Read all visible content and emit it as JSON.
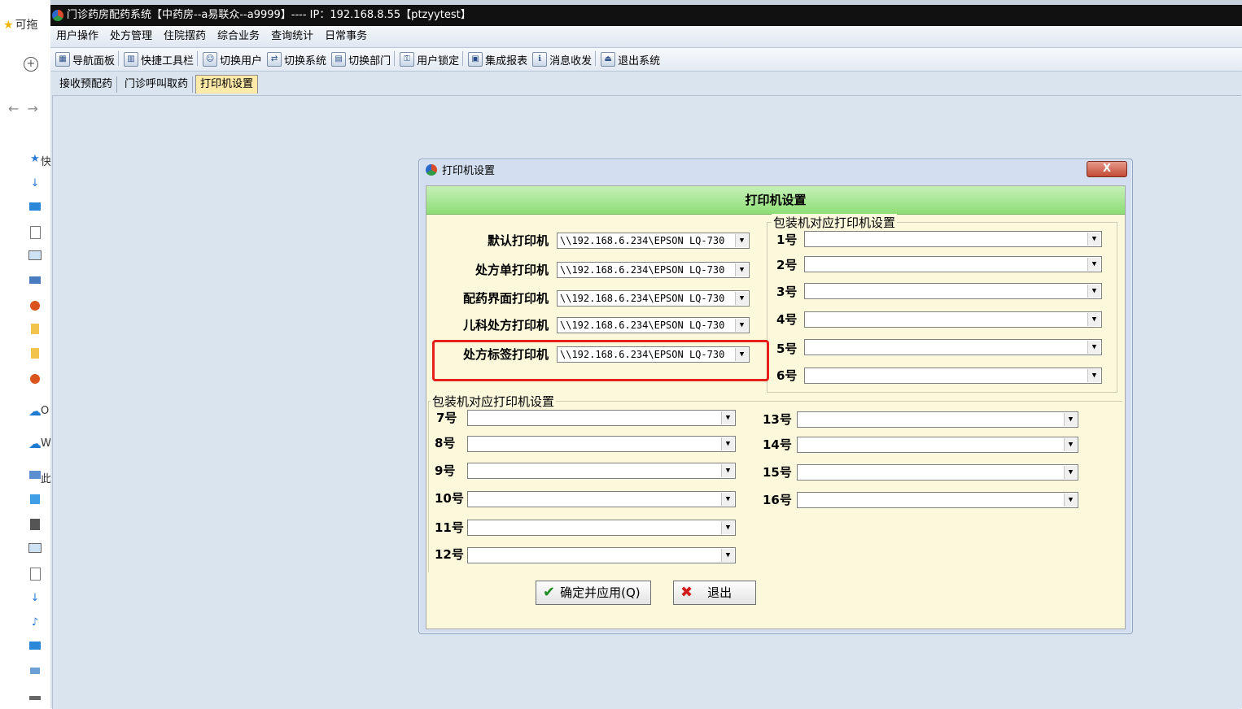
{
  "left_panel": {
    "favorites_label": "可拖",
    "items": [
      {
        "icon": "quick-access-icon",
        "text": "快"
      },
      {
        "icon": "onedrive-icon",
        "text": "O"
      },
      {
        "icon": "onedrive-cloud-icon",
        "text": "W"
      },
      {
        "icon": "this-pc-icon",
        "text": "此"
      }
    ]
  },
  "window": {
    "title": "门诊药房配药系统【中药房--a易联众--a9999】---- IP：192.168.8.55【ptzyytest】"
  },
  "menu": [
    "用户操作",
    "处方管理",
    "住院摆药",
    "综合业务",
    "查询统计",
    "日常事务"
  ],
  "toolbar": [
    {
      "icon": "nav-panel-icon",
      "label": "导航面板"
    },
    {
      "icon": "quick-toolbar-icon",
      "label": "快捷工具栏"
    },
    {
      "icon": "switch-user-icon",
      "label": "切换用户"
    },
    {
      "icon": "switch-system-icon",
      "label": "切换系统"
    },
    {
      "icon": "switch-dept-icon",
      "label": "切换部门"
    },
    {
      "icon": "user-lock-icon",
      "label": "用户锁定"
    },
    {
      "icon": "report-icon",
      "label": "集成报表"
    },
    {
      "icon": "message-icon",
      "label": "消息收发"
    },
    {
      "icon": "exit-icon",
      "label": "退出系统"
    }
  ],
  "tabs": [
    "接收预配药",
    "门诊呼叫取药",
    "打印机设置"
  ],
  "dialog": {
    "window_title": "打印机设置",
    "close_label": "X",
    "header": "打印机设置",
    "printers": [
      {
        "label": "默认打印机",
        "value": "\\\\192.168.6.234\\EPSON LQ-730"
      },
      {
        "label": "处方单打印机",
        "value": "\\\\192.168.6.234\\EPSON LQ-730"
      },
      {
        "label": "配药界面打印机",
        "value": "\\\\192.168.6.234\\EPSON LQ-730"
      },
      {
        "label": "儿科处方打印机",
        "value": "\\\\192.168.6.234\\EPSON LQ-730"
      },
      {
        "label": "处方标签打印机",
        "value": "\\\\192.168.6.234\\EPSON LQ-730"
      }
    ],
    "group1_title": "包装机对应打印机设置",
    "group1_slots": [
      "1号",
      "2号",
      "3号",
      "4号",
      "5号",
      "6号"
    ],
    "group2_title": "包装机对应打印机设置",
    "group2_left_slots": [
      "7号",
      "8号",
      "9号",
      "10号",
      "11号",
      "12号"
    ],
    "group2_right_slots": [
      "13号",
      "14号",
      "15号",
      "16号"
    ],
    "confirm_label": "确定并应用(Q)",
    "exit_label": "退出"
  }
}
